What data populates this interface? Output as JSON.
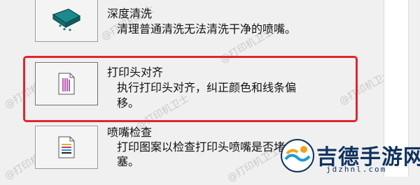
{
  "items": [
    {
      "title": "深度清洗",
      "description": "清理普通清洗无法清洗干净的喷嘴。",
      "icon": "deep-clean-icon"
    },
    {
      "title": "打印头对齐",
      "description_line1": "执行打印头对齐，纠正颜色和线条偏",
      "description_line2": "移。",
      "icon": "printhead-alignment-icon"
    },
    {
      "title": "喷嘴检查",
      "description_line1": "打印图案以检查打印头喷嘴是否堵",
      "description_line2": "塞。",
      "icon": "nozzle-check-icon"
    }
  ],
  "watermark": {
    "text": "@打印机卫士"
  },
  "logo": {
    "name": "吉德手游网",
    "domain": "jdzhnl.com"
  },
  "colors": {
    "highlight": "#e0262d",
    "logo_text": "#10325f",
    "teal_icon": "#1b8a8c"
  }
}
